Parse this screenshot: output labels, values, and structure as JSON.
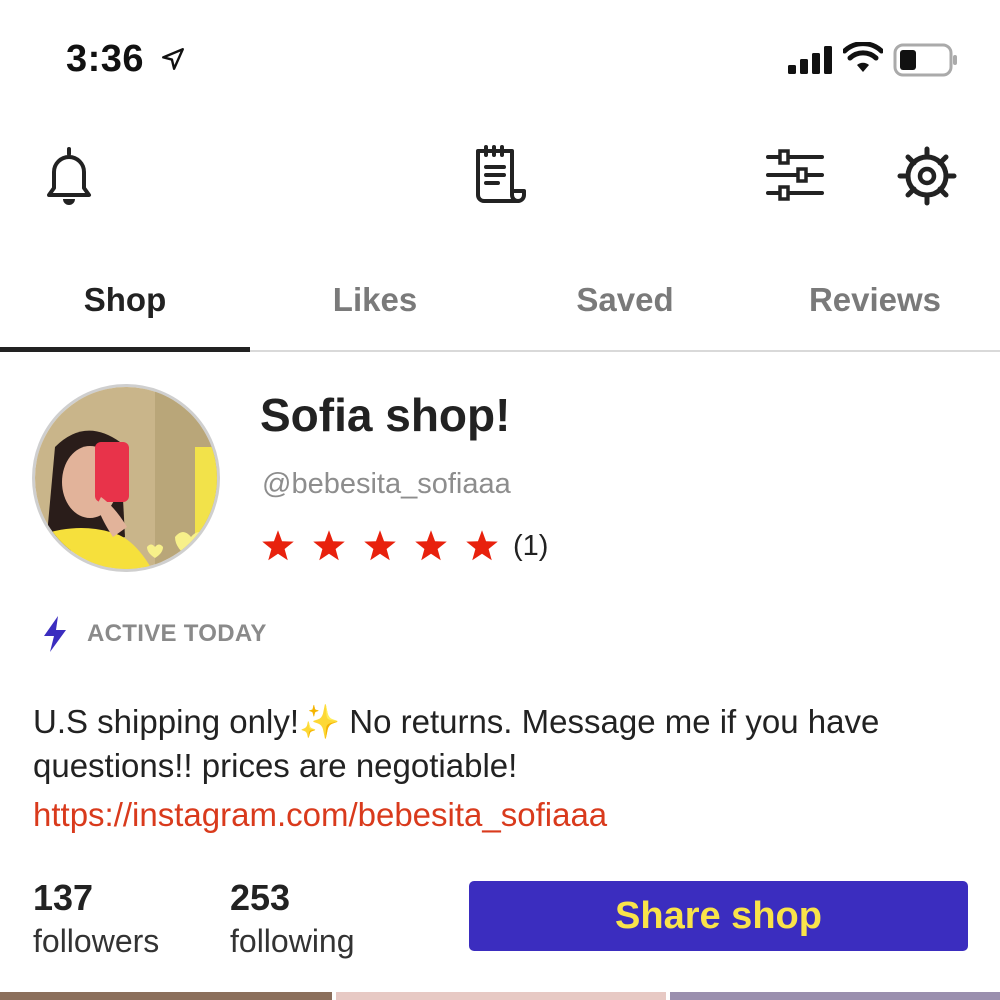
{
  "status_bar": {
    "time": "3:36",
    "icons": [
      "location-arrow-icon",
      "signal-icon",
      "wifi-icon",
      "battery-icon"
    ]
  },
  "toolbar": {
    "icons": [
      "bell-icon",
      "receipt-icon",
      "sliders-icon",
      "gear-icon"
    ]
  },
  "tabs": [
    {
      "label": "Shop",
      "active": true
    },
    {
      "label": "Likes",
      "active": false
    },
    {
      "label": "Saved",
      "active": false
    },
    {
      "label": "Reviews",
      "active": false
    }
  ],
  "profile": {
    "shop_name": "Sofia shop!",
    "username": "@bebesita_sofiaaa",
    "rating": {
      "stars": 5,
      "review_count": "(1)"
    },
    "activity": "ACTIVE TODAY",
    "bio": {
      "part1": "U.S shipping only!",
      "sparkle": "✨",
      "part2": " No returns. Message me if you have questions!! prices are negotiable!"
    },
    "link": "https://instagram.com/bebesita_sofiaaa"
  },
  "stats": {
    "followers": {
      "count": "137",
      "label": "followers"
    },
    "following": {
      "count": "253",
      "label": "following"
    }
  },
  "share_button": {
    "label": "Share shop"
  },
  "colors": {
    "accent_purple": "#3b2dbf",
    "button_text_yellow": "#f9e34a",
    "star_red": "#e8210d",
    "link_red": "#d93a1c",
    "bolt_blue": "#3b2dbf"
  }
}
